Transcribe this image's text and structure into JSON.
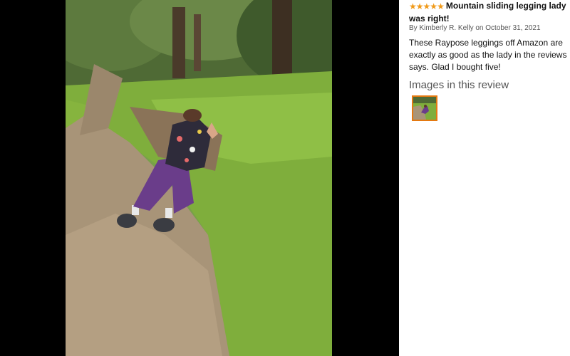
{
  "review": {
    "rating_stars": 5,
    "title": "Mountain sliding legging lady was right!",
    "byline": "By Kimberly R. Kelly on October 31, 2021",
    "body": "These Raypose leggings off Amazon are exactly as good as the lady in the reviews says. Glad I bought five!"
  },
  "images_section": {
    "heading": "Images in this review"
  },
  "colors": {
    "star": "#f09a1a",
    "thumb_border": "#e47911",
    "viewer_bg": "#000000"
  }
}
